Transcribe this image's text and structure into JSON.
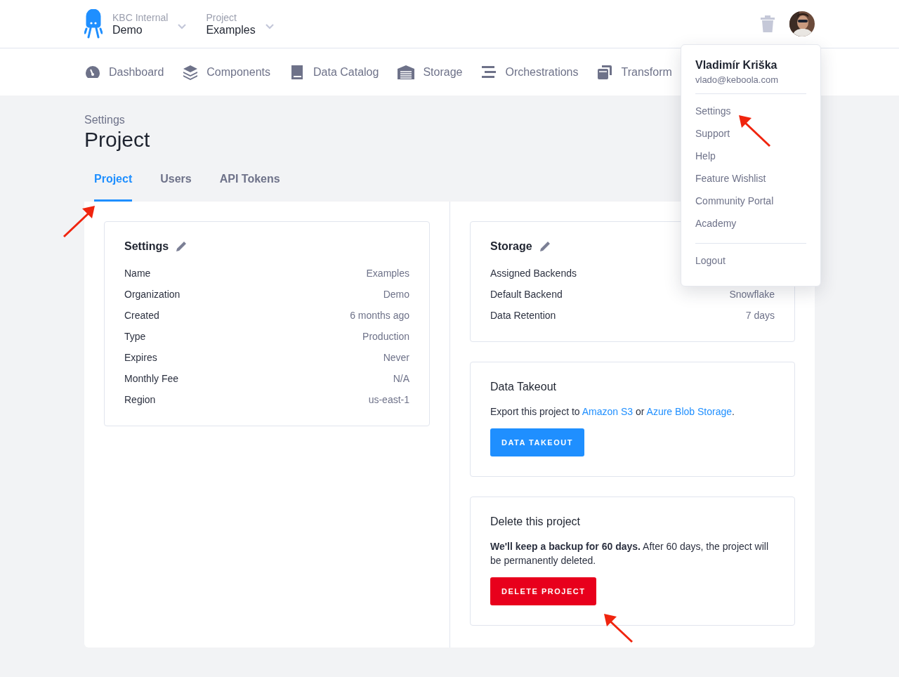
{
  "header": {
    "organization": {
      "label": "KBC Internal",
      "value": "Demo"
    },
    "project": {
      "label": "Project",
      "value": "Examples"
    }
  },
  "nav": [
    {
      "label": "Dashboard",
      "kind": "gauge"
    },
    {
      "label": "Components",
      "kind": "layers"
    },
    {
      "label": "Data Catalog",
      "kind": "book"
    },
    {
      "label": "Storage",
      "kind": "warehouse"
    },
    {
      "label": "Orchestrations",
      "kind": "bars"
    },
    {
      "label": "Transform",
      "kind": "copy"
    }
  ],
  "page": {
    "breadcrumb": "Settings",
    "title": "Project"
  },
  "tabs": [
    {
      "label": "Project",
      "selected": true
    },
    {
      "label": "Users",
      "selected": false
    },
    {
      "label": "API Tokens",
      "selected": false
    }
  ],
  "settings_card": {
    "title": "Settings",
    "rows": [
      {
        "label": "Name",
        "value": "Examples"
      },
      {
        "label": "Organization",
        "value": "Demo"
      },
      {
        "label": "Created",
        "value": "6 months ago"
      },
      {
        "label": "Type",
        "value": "Production"
      },
      {
        "label": "Expires",
        "value": "Never"
      },
      {
        "label": "Monthly Fee",
        "value": "N/A"
      },
      {
        "label": "Region",
        "value": "us-east-1"
      }
    ]
  },
  "storage_card": {
    "title": "Storage",
    "rows": [
      {
        "label": "Assigned Backends"
      },
      {
        "label": "Default Backend",
        "value": "Snowflake"
      },
      {
        "label": "Data Retention",
        "value": "7 days"
      }
    ]
  },
  "takeout_card": {
    "title": "Data Takeout",
    "text_before": "Export this project to ",
    "link_1": "Amazon S3",
    "text_middle": " or ",
    "link_2": "Azure Blob Storage",
    "text_after": ".",
    "button": "DATA TAKEOUT"
  },
  "delete_card": {
    "title": "Delete this project",
    "text": "**We'll keep a backup for 60 days.** After 60 days, the project will be permanently deleted.",
    "button": "DELETE PROJECT"
  },
  "user_menu": {
    "name": "Vladimír Kriška",
    "email": "vlado@keboola.com",
    "items": [
      "Settings",
      "Support",
      "Help",
      "Feature Wishlist",
      "Community Portal",
      "Academy"
    ],
    "logout": "Logout"
  }
}
